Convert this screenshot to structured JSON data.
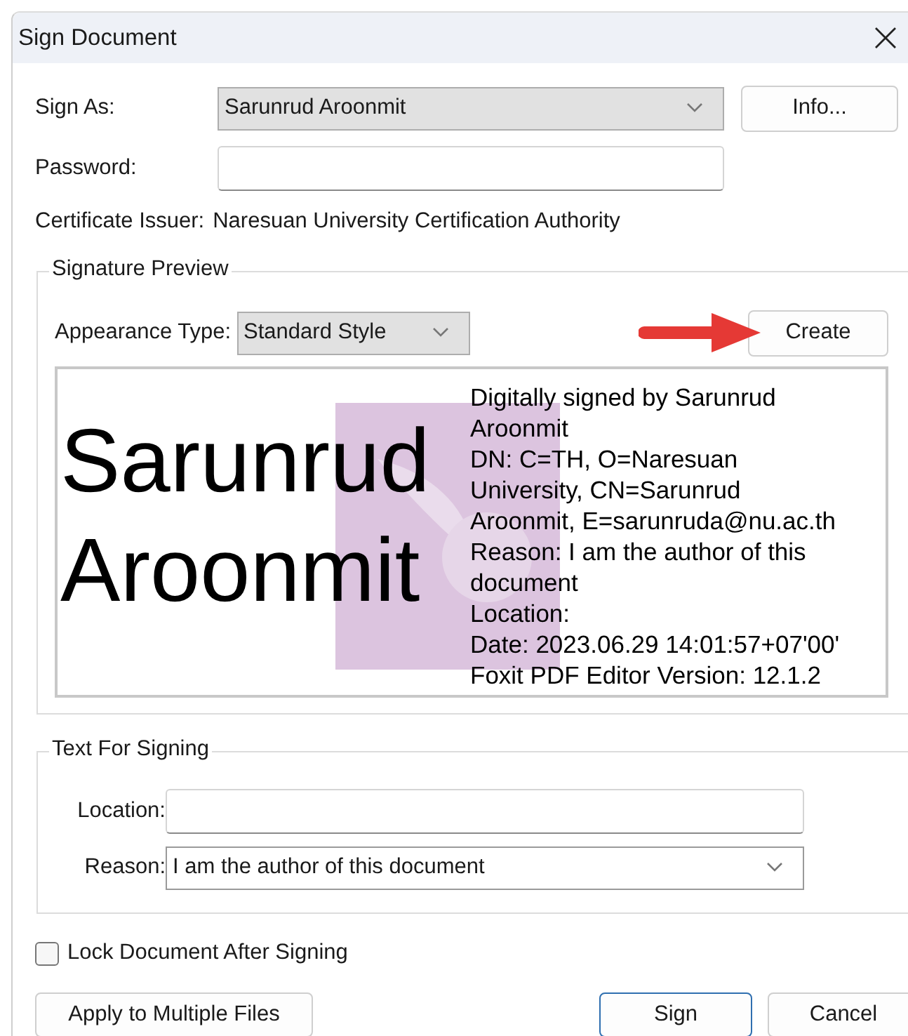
{
  "window": {
    "title": "Sign Document"
  },
  "sign_as": {
    "label": "Sign As:",
    "value": "Sarunrud Aroonmit"
  },
  "info_button": {
    "label": "Info..."
  },
  "password": {
    "label": "Password:"
  },
  "certificate_issuer": {
    "label": "Certificate Issuer:",
    "value": "Naresuan University Certification Authority"
  },
  "signature_preview": {
    "title": "Signature Preview",
    "appearance_type": {
      "label": "Appearance Type:",
      "value": "Standard Style"
    },
    "create_button": {
      "label": "Create"
    },
    "preview": {
      "name_lines": [
        "Sarunrud",
        "Aroonmit"
      ],
      "details": [
        "Digitally signed by Sarunrud",
        "Aroonmit",
        "DN: C=TH, O=Naresuan",
        "University, CN=Sarunrud",
        "Aroonmit, E=sarunruda@nu.ac.th",
        "Reason: I am the author of this",
        "document",
        "Location:",
        "Date: 2023.06.29 14:01:57+07'00'",
        "Foxit PDF Editor Version: 12.1.2"
      ]
    }
  },
  "text_for_signing": {
    "title": "Text For Signing",
    "location": {
      "label": "Location:"
    },
    "reason": {
      "label": "Reason:",
      "value": "I am the author of this document"
    }
  },
  "lock_document": {
    "label": "Lock Document After Signing",
    "checked": false
  },
  "buttons": [
    {
      "label": "Apply to Multiple Files",
      "default": false
    },
    {
      "label": "Sign",
      "default": true
    },
    {
      "label": "Cancel",
      "default": false
    }
  ]
}
